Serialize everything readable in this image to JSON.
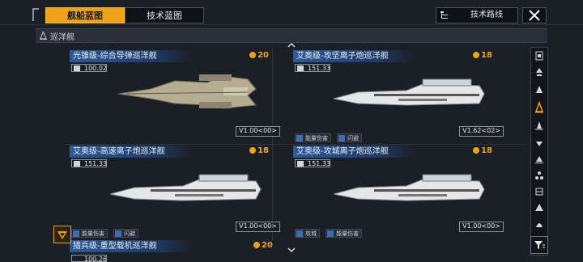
{
  "tabs": [
    {
      "label": "舰船蓝图",
      "active": true
    },
    {
      "label": "技术蓝图",
      "active": false
    }
  ],
  "route_button": {
    "label": "技术路线"
  },
  "category": {
    "label": "巡洋舰"
  },
  "cards": [
    {
      "title": "光锥级-综合导弹巡洋舰",
      "cost": "20",
      "stat": "100.02",
      "version": "V1.00<00>",
      "tags": [],
      "ship_color": "tan"
    },
    {
      "title": "艾奥级-攻坚离子炮巡洋舰",
      "cost": "18",
      "stat": "151.33",
      "version": "V1.62<02>",
      "tags": [
        "能量伤害",
        "闪避"
      ],
      "ship_color": "white"
    },
    {
      "title": "艾奥级-高速离子炮巡洋舰",
      "cost": "18",
      "stat": "151.33",
      "version": "V1.00<00>",
      "tags": [
        "能量伤害",
        "闪避"
      ],
      "ship_color": "white"
    },
    {
      "title": "艾奥级-攻城离子炮巡洋舰",
      "cost": "18",
      "stat": "151.33",
      "version": "V1.00<00>",
      "tags": [
        "攻城",
        "能量伤害"
      ],
      "ship_color": "white"
    }
  ],
  "bottom_card": {
    "title": "猎兵级-重型载机巡洋舰",
    "cost": "20",
    "stat": "100.26"
  },
  "side_filters": [
    "all-icon",
    "frigate-icon",
    "destroyer-icon",
    "cruiser-icon",
    "battlecruiser-icon",
    "auxiliary-icon",
    "carrier-icon",
    "battleship-icon",
    "station-icon",
    "dreadnought-icon",
    "titan-icon"
  ],
  "colors": {
    "accent": "#f0a21a",
    "title_blue": "#2d5a9a",
    "bg": "#1b2026"
  }
}
